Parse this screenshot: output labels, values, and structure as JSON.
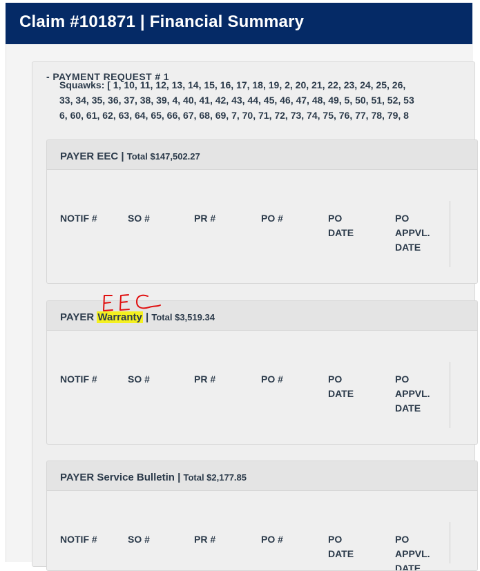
{
  "header": {
    "title": "Claim #101871 | Financial Summary"
  },
  "payment_request": {
    "title": "- PAYMENT REQUEST # 1",
    "squawks_lines": [
      "Squawks: [ 1, 10, 11, 12, 13, 14, 15, 16, 17, 18, 19, 2, 20, 21, 22, 23, 24, 25, 26,",
      "33, 34, 35, 36, 37, 38, 39, 4, 40, 41, 42, 43, 44, 45, 46, 47, 48, 49, 5, 50, 51, 52, 53",
      "6, 60, 61, 62, 63, 64, 65, 66, 67, 68, 69, 7, 70, 71, 72, 73, 74, 75, 76, 77, 78, 79, 8"
    ]
  },
  "columns": [
    "NOTIF #",
    "SO #",
    "PR #",
    "PO #",
    "PO DATE",
    "PO APPVL. DATE"
  ],
  "payers": [
    {
      "prefix": "PAYER",
      "name": "EEC",
      "separator": "|",
      "total": "Total $147,502.27",
      "highlight": false
    },
    {
      "prefix": "PAYER",
      "name": "Warranty",
      "separator": "|",
      "total": "Total $3,519.34",
      "highlight": true
    },
    {
      "prefix": "PAYER",
      "name": "Service Bulletin",
      "separator": "|",
      "total": "Total $2,177.85",
      "highlight": false
    }
  ],
  "annotation": {
    "text": "EEC",
    "color": "#e01010"
  }
}
